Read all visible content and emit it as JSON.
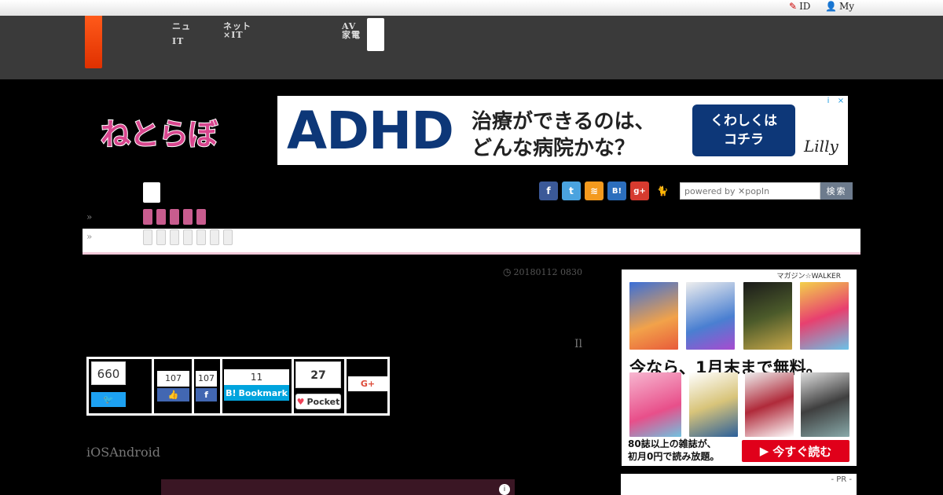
{
  "topbar": {
    "id_label": "ID",
    "my_label": "My"
  },
  "header": {
    "nav": [
      {
        "line1": "ニュ",
        "line2": "IT"
      },
      {
        "line1": "ネット",
        "line2": "×IT"
      },
      {
        "line1": "AV",
        "line2": "家電"
      }
    ]
  },
  "logo": {
    "text": "ねとらぼ"
  },
  "ad_banner": {
    "headline": "ADHD",
    "line1": "治療ができるのは、",
    "line2": "どんな病院かな？",
    "cta_line1": "くわしくは",
    "cta_line2": "コチラ",
    "brand": "Lilly",
    "info_icon": "i",
    "close_icon": "×"
  },
  "social_icons": [
    "facebook-icon",
    "twitter-icon",
    "rss-icon",
    "hatena-icon",
    "googleplus-icon",
    "cat-icon"
  ],
  "social_labels": {
    "facebook": "f",
    "twitter": "t",
    "rss": "≋",
    "hatena": "B!",
    "gplus": "g+",
    "cat": "🐈"
  },
  "search": {
    "placeholder": "powered by ✕popIn",
    "button": "検索"
  },
  "breadcrumb": {
    "arrow": "»"
  },
  "article": {
    "date": "20180112 0830",
    "page_marker": "Il",
    "subtext": "iOSAndroid"
  },
  "share": {
    "twitter_count": "660",
    "facebook_like_count": "107",
    "facebook_share_count": "107",
    "hatena_count": "11",
    "hatena_label": "Bookmark",
    "pocket_count": "27",
    "pocket_label": "Pocket",
    "gplus_label": "G+"
  },
  "side_ad": {
    "brand": "マガジン☆WALKER",
    "headline": "今なら、1月末まで無料。",
    "bottom_line1": "80誌以上の雑誌が、",
    "bottom_line2": "初月0円で読み放題。",
    "cta": "今すぐ読む"
  },
  "pr_label": "- PR -"
}
